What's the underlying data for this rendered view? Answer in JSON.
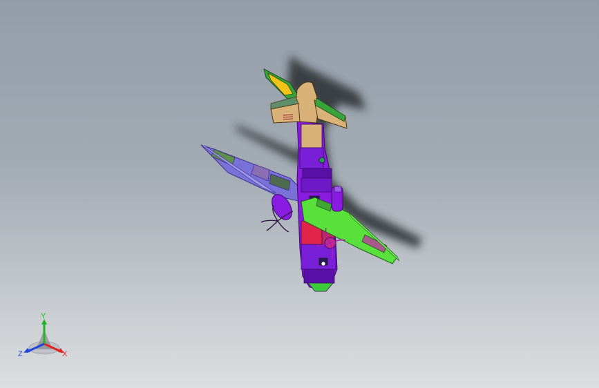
{
  "viewport": {
    "background_top": "#939da8",
    "background_bottom": "#dcdedf"
  },
  "model": {
    "colors": {
      "fuselage": "#8a1be0",
      "fuselage_dark": "#5a0fa6",
      "tail": "#d9b27a",
      "tail_green": "#39a43a",
      "tail_yellow": "#f2c318",
      "left_wing": "#7a72d8",
      "right_wing": "#59e03a",
      "nose_red": "#e0244a",
      "shadow": "#2a2d31"
    }
  },
  "triad": {
    "x_label": "X",
    "y_label": "Y",
    "z_label": "Z",
    "x_color": "#e02222",
    "y_color": "#22b522",
    "z_color": "#2244dd"
  }
}
